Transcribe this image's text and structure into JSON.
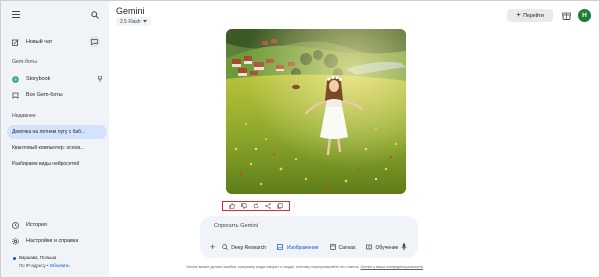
{
  "sidebar": {
    "new_chat": "Новый чат",
    "gems_section": "Gem-боты",
    "gems": [
      {
        "label": "Storybook",
        "icon": "storybook-icon"
      },
      {
        "label": "Все Gem-боты",
        "icon": "gem-icon"
      }
    ],
    "recent_section": "Недавнее",
    "recent": [
      {
        "label": "Девочка на летнем лугу с баб...",
        "active": true
      },
      {
        "label": "Квантовый компьютер: основ...",
        "active": false
      },
      {
        "label": "Разбираем виды нейросетей",
        "active": false
      }
    ],
    "history": "История",
    "settings": "Настройки и справка",
    "location_line1": "Варшава, Польша",
    "location_line2_prefix": "По IP-адресу • ",
    "location_update": "Обновить"
  },
  "header": {
    "title": "Gemini",
    "model": "2.5 Flash",
    "goto_label": "Перейти",
    "avatar_letter": "H",
    "avatar_color": "#1e7e34"
  },
  "response": {
    "image_description_icons": [
      "thumbs-up-icon",
      "thumbs-down-icon",
      "regenerate-icon",
      "share-icon",
      "copy-icon"
    ]
  },
  "input": {
    "placeholder": "Спросить Gemini",
    "tools": [
      {
        "label": "Deep Research",
        "icon": "deep-research-icon",
        "active": false
      },
      {
        "label": "Изображение",
        "icon": "image-icon",
        "active": true
      },
      {
        "label": "Canvas",
        "icon": "canvas-icon",
        "active": false
      },
      {
        "label": "Обучение",
        "icon": "learning-icon",
        "active": false
      }
    ]
  },
  "footer": {
    "disclaimer": "Gemini может делать ошибки, например когда говорит о людях, поэтому перепроверяйте его ответы.",
    "privacy_link": "Gemini и ваша конфиденциальность"
  },
  "colors": {
    "accent": "#0b57d0",
    "sidebar_bg": "#f0f4f9",
    "active_item": "#d3e3fd",
    "highlight_border": "#d93025"
  }
}
